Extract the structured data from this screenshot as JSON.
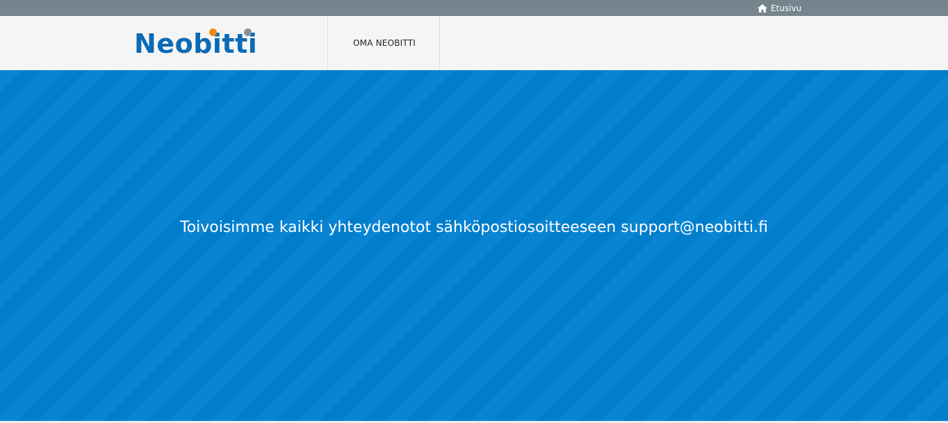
{
  "topbar": {
    "home_label": "Etusivu",
    "home_icon": "home-icon"
  },
  "header": {
    "logo_text": "Neobitti",
    "nav_items": [
      {
        "label": "OMA NEOBITTI"
      }
    ]
  },
  "hero": {
    "message": "Toivoisimme kaikki yhteydenotot sähköpostiosoitteeseen support@neobitti.fi"
  },
  "colors": {
    "topbar": "#76848e",
    "header_bg": "#f5f5f5",
    "brand_blue": "#0a6ab6",
    "hero_bg": "#0080d0",
    "logo_orange_dot": "#f08a14"
  }
}
